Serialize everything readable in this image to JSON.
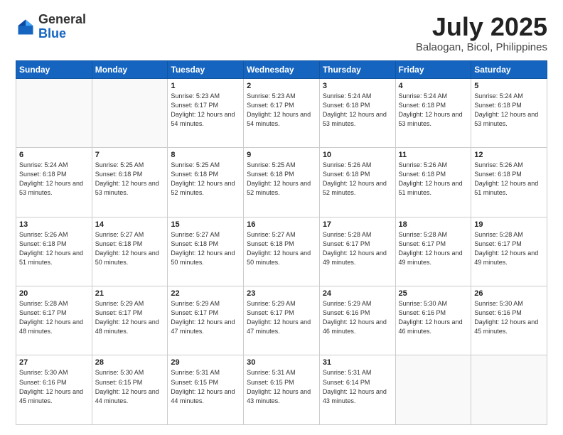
{
  "header": {
    "logo_general": "General",
    "logo_blue": "Blue",
    "month_title": "July 2025",
    "location": "Balaogan, Bicol, Philippines"
  },
  "weekdays": [
    "Sunday",
    "Monday",
    "Tuesday",
    "Wednesday",
    "Thursday",
    "Friday",
    "Saturday"
  ],
  "weeks": [
    [
      {
        "day": "",
        "sunrise": "",
        "sunset": "",
        "daylight": ""
      },
      {
        "day": "",
        "sunrise": "",
        "sunset": "",
        "daylight": ""
      },
      {
        "day": "1",
        "sunrise": "Sunrise: 5:23 AM",
        "sunset": "Sunset: 6:17 PM",
        "daylight": "Daylight: 12 hours and 54 minutes."
      },
      {
        "day": "2",
        "sunrise": "Sunrise: 5:23 AM",
        "sunset": "Sunset: 6:17 PM",
        "daylight": "Daylight: 12 hours and 54 minutes."
      },
      {
        "day": "3",
        "sunrise": "Sunrise: 5:24 AM",
        "sunset": "Sunset: 6:18 PM",
        "daylight": "Daylight: 12 hours and 53 minutes."
      },
      {
        "day": "4",
        "sunrise": "Sunrise: 5:24 AM",
        "sunset": "Sunset: 6:18 PM",
        "daylight": "Daylight: 12 hours and 53 minutes."
      },
      {
        "day": "5",
        "sunrise": "Sunrise: 5:24 AM",
        "sunset": "Sunset: 6:18 PM",
        "daylight": "Daylight: 12 hours and 53 minutes."
      }
    ],
    [
      {
        "day": "6",
        "sunrise": "Sunrise: 5:24 AM",
        "sunset": "Sunset: 6:18 PM",
        "daylight": "Daylight: 12 hours and 53 minutes."
      },
      {
        "day": "7",
        "sunrise": "Sunrise: 5:25 AM",
        "sunset": "Sunset: 6:18 PM",
        "daylight": "Daylight: 12 hours and 53 minutes."
      },
      {
        "day": "8",
        "sunrise": "Sunrise: 5:25 AM",
        "sunset": "Sunset: 6:18 PM",
        "daylight": "Daylight: 12 hours and 52 minutes."
      },
      {
        "day": "9",
        "sunrise": "Sunrise: 5:25 AM",
        "sunset": "Sunset: 6:18 PM",
        "daylight": "Daylight: 12 hours and 52 minutes."
      },
      {
        "day": "10",
        "sunrise": "Sunrise: 5:26 AM",
        "sunset": "Sunset: 6:18 PM",
        "daylight": "Daylight: 12 hours and 52 minutes."
      },
      {
        "day": "11",
        "sunrise": "Sunrise: 5:26 AM",
        "sunset": "Sunset: 6:18 PM",
        "daylight": "Daylight: 12 hours and 51 minutes."
      },
      {
        "day": "12",
        "sunrise": "Sunrise: 5:26 AM",
        "sunset": "Sunset: 6:18 PM",
        "daylight": "Daylight: 12 hours and 51 minutes."
      }
    ],
    [
      {
        "day": "13",
        "sunrise": "Sunrise: 5:26 AM",
        "sunset": "Sunset: 6:18 PM",
        "daylight": "Daylight: 12 hours and 51 minutes."
      },
      {
        "day": "14",
        "sunrise": "Sunrise: 5:27 AM",
        "sunset": "Sunset: 6:18 PM",
        "daylight": "Daylight: 12 hours and 50 minutes."
      },
      {
        "day": "15",
        "sunrise": "Sunrise: 5:27 AM",
        "sunset": "Sunset: 6:18 PM",
        "daylight": "Daylight: 12 hours and 50 minutes."
      },
      {
        "day": "16",
        "sunrise": "Sunrise: 5:27 AM",
        "sunset": "Sunset: 6:18 PM",
        "daylight": "Daylight: 12 hours and 50 minutes."
      },
      {
        "day": "17",
        "sunrise": "Sunrise: 5:28 AM",
        "sunset": "Sunset: 6:17 PM",
        "daylight": "Daylight: 12 hours and 49 minutes."
      },
      {
        "day": "18",
        "sunrise": "Sunrise: 5:28 AM",
        "sunset": "Sunset: 6:17 PM",
        "daylight": "Daylight: 12 hours and 49 minutes."
      },
      {
        "day": "19",
        "sunrise": "Sunrise: 5:28 AM",
        "sunset": "Sunset: 6:17 PM",
        "daylight": "Daylight: 12 hours and 49 minutes."
      }
    ],
    [
      {
        "day": "20",
        "sunrise": "Sunrise: 5:28 AM",
        "sunset": "Sunset: 6:17 PM",
        "daylight": "Daylight: 12 hours and 48 minutes."
      },
      {
        "day": "21",
        "sunrise": "Sunrise: 5:29 AM",
        "sunset": "Sunset: 6:17 PM",
        "daylight": "Daylight: 12 hours and 48 minutes."
      },
      {
        "day": "22",
        "sunrise": "Sunrise: 5:29 AM",
        "sunset": "Sunset: 6:17 PM",
        "daylight": "Daylight: 12 hours and 47 minutes."
      },
      {
        "day": "23",
        "sunrise": "Sunrise: 5:29 AM",
        "sunset": "Sunset: 6:17 PM",
        "daylight": "Daylight: 12 hours and 47 minutes."
      },
      {
        "day": "24",
        "sunrise": "Sunrise: 5:29 AM",
        "sunset": "Sunset: 6:16 PM",
        "daylight": "Daylight: 12 hours and 46 minutes."
      },
      {
        "day": "25",
        "sunrise": "Sunrise: 5:30 AM",
        "sunset": "Sunset: 6:16 PM",
        "daylight": "Daylight: 12 hours and 46 minutes."
      },
      {
        "day": "26",
        "sunrise": "Sunrise: 5:30 AM",
        "sunset": "Sunset: 6:16 PM",
        "daylight": "Daylight: 12 hours and 45 minutes."
      }
    ],
    [
      {
        "day": "27",
        "sunrise": "Sunrise: 5:30 AM",
        "sunset": "Sunset: 6:16 PM",
        "daylight": "Daylight: 12 hours and 45 minutes."
      },
      {
        "day": "28",
        "sunrise": "Sunrise: 5:30 AM",
        "sunset": "Sunset: 6:15 PM",
        "daylight": "Daylight: 12 hours and 44 minutes."
      },
      {
        "day": "29",
        "sunrise": "Sunrise: 5:31 AM",
        "sunset": "Sunset: 6:15 PM",
        "daylight": "Daylight: 12 hours and 44 minutes."
      },
      {
        "day": "30",
        "sunrise": "Sunrise: 5:31 AM",
        "sunset": "Sunset: 6:15 PM",
        "daylight": "Daylight: 12 hours and 43 minutes."
      },
      {
        "day": "31",
        "sunrise": "Sunrise: 5:31 AM",
        "sunset": "Sunset: 6:14 PM",
        "daylight": "Daylight: 12 hours and 43 minutes."
      },
      {
        "day": "",
        "sunrise": "",
        "sunset": "",
        "daylight": ""
      },
      {
        "day": "",
        "sunrise": "",
        "sunset": "",
        "daylight": ""
      }
    ]
  ]
}
